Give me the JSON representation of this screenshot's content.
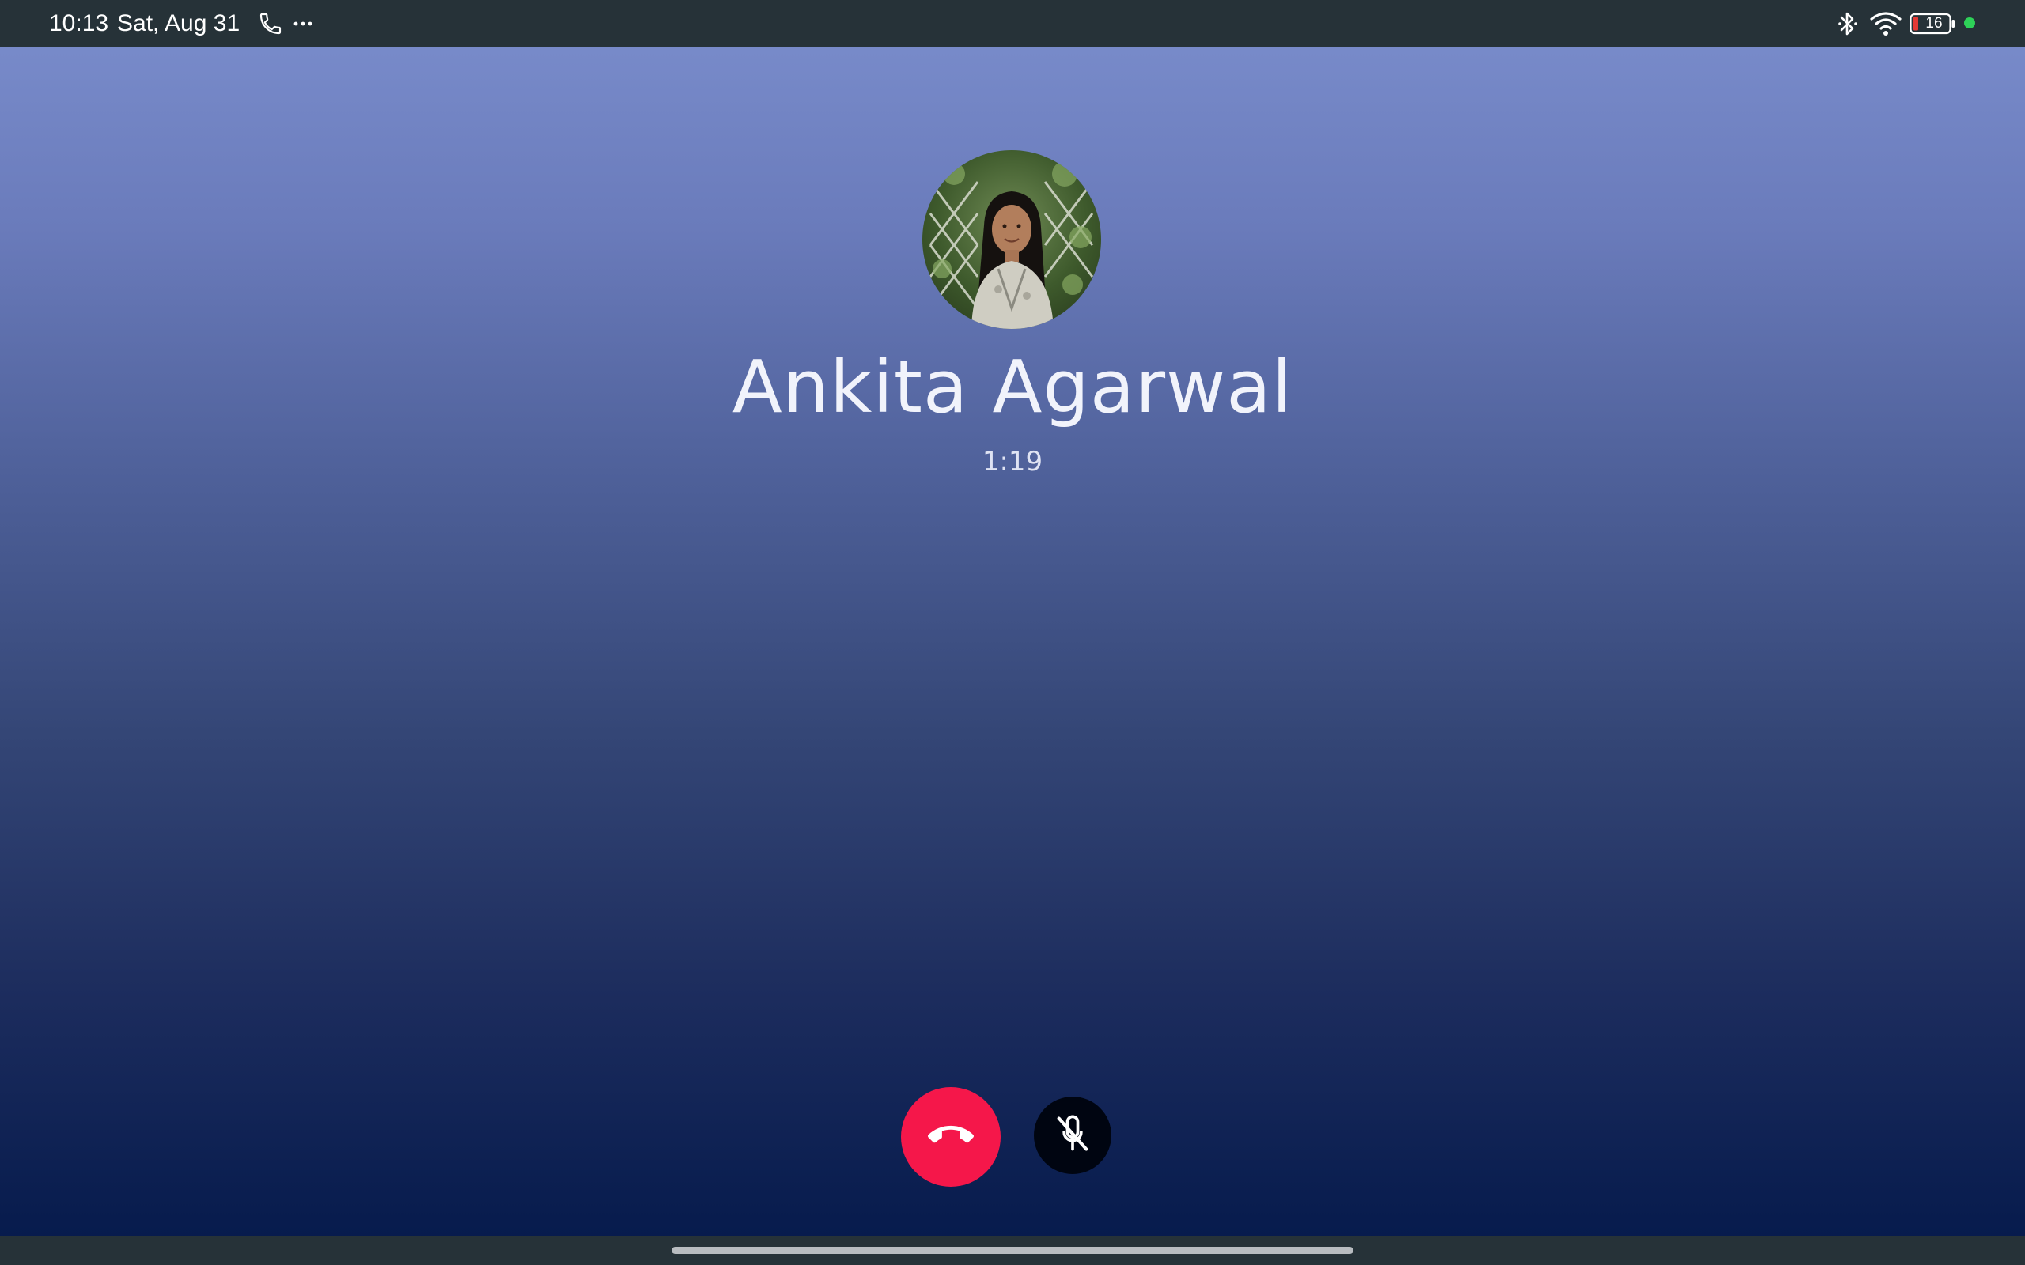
{
  "status_bar": {
    "time": "10:13",
    "date": "Sat, Aug 31",
    "battery_level": "16",
    "icons": [
      "phone-call-icon",
      "more-notifications-icon",
      "bluetooth-icon",
      "wifi-icon",
      "battery-icon",
      "camera-privacy-indicator-icon"
    ]
  },
  "call": {
    "caller_name": "Ankita Agarwal",
    "duration": "1:19"
  },
  "controls": {
    "end_call_icon": "call-end-icon",
    "mute_icon": "mic-off-icon"
  },
  "colors": {
    "status_bar_bg": "#263238",
    "end_call_red": "#f5174a",
    "mute_button_bg": "#000511",
    "privacy_dot_green": "#2ed158",
    "battery_low_red": "#e53935",
    "gradient_top": "#7b8ecd",
    "gradient_bottom": "#04194b"
  }
}
